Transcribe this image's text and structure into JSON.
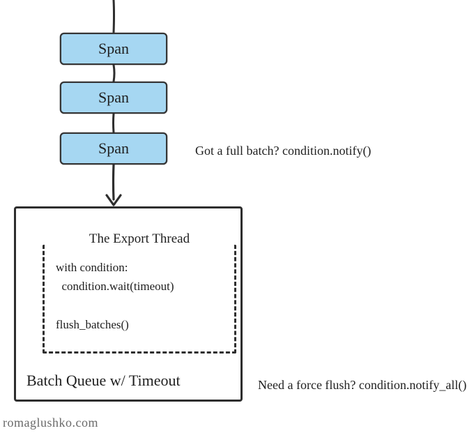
{
  "diagram": {
    "spans": [
      {
        "label": "Span"
      },
      {
        "label": "Span"
      },
      {
        "label": "Span"
      }
    ],
    "annotations": {
      "full_batch": "Got a full batch? condition.notify()",
      "force_flush": "Need a force flush? condition.notify_all()"
    },
    "batch_box": {
      "title": "Batch Queue w/ Timeout",
      "export_thread": {
        "title": "The Export Thread",
        "code": "with condition:\n  condition.wait(timeout)\n\nflush_batches()"
      }
    },
    "attribution": "romaglushko.com",
    "colors": {
      "span_fill": "#a6d7f2",
      "stroke": "#2e2e2e"
    }
  }
}
